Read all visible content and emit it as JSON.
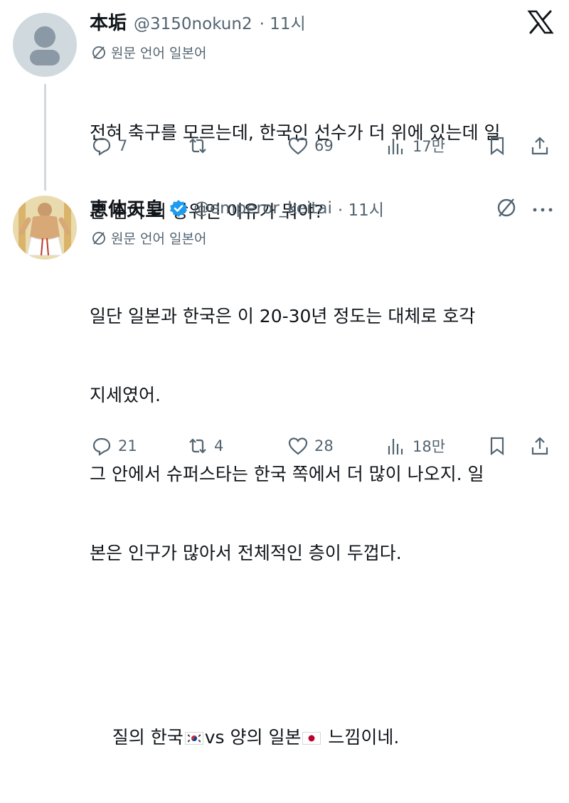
{
  "tweet1": {
    "name": "本垢",
    "handle": "@3150nokun2",
    "time": "· 11시",
    "translation_label": "원문 언어 일본어",
    "lines": [
      "전혀 축구를 모르는데, 한국인 선수가 더 위에 있는데 일",
      "본 팀이 더 상위인 이유가 뭐야?"
    ],
    "replies": "7",
    "retweets": "",
    "likes": "69",
    "views": "17만"
  },
  "tweet2": {
    "name": "恵体天皇",
    "handle": "@emperor_keitai",
    "time": "· 11시",
    "translation_label": "원문 언어 일본어",
    "lines": [
      "일단 일본과 한국은 이 20-30년 정도는 대체로 호각",
      "지세였어.",
      "그 안에서 슈퍼스타는 한국 쪽에서 더 많이 나오지. 일",
      "본은 인구가 많아서 전체적인 층이 두껍다."
    ],
    "last_line": {
      "part1": "질의 한국",
      "part2": "vs 양의 일본",
      "part3": " 느낌이네."
    },
    "replies": "21",
    "retweets": "4",
    "likes": "28",
    "views": "18만"
  },
  "colors": {
    "text": "#0f1419",
    "secondary": "#536471",
    "verified": "#1d9bf0"
  }
}
